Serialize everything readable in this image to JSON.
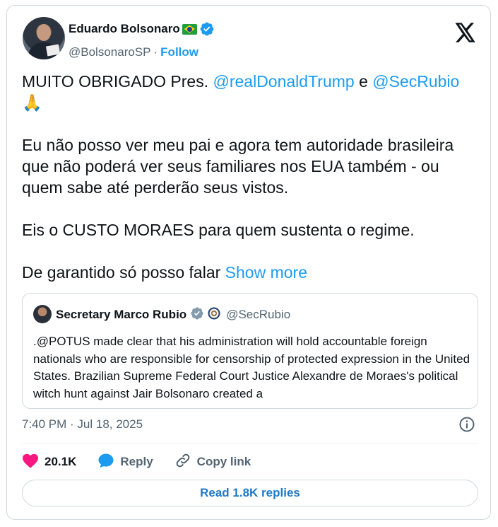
{
  "author": {
    "name": "Eduardo Bolsonaro",
    "handle": "@BolsonaroSP",
    "separator": "·",
    "follow_label": "Follow"
  },
  "tweet": {
    "line1_prefix": "MUITO OBRIGADO Pres. ",
    "mention1": "@realDonaldTrump",
    "line1_mid": " e ",
    "mention2": "@SecRubio",
    "emoji": "🙏",
    "para2": "Eu não posso ver meu pai e agora tem autoridade brasileira que não poderá ver seus familiares nos EUA também - ou quem sabe até perderão seus vistos.",
    "para3": "Eis o CUSTO MORAES para quem sustenta o regime.",
    "para4": "De garantido só posso falar ",
    "show_more": "Show more"
  },
  "quote": {
    "name": "Secretary Marco Rubio",
    "handle": "@SecRubio",
    "text": ".@POTUS made clear that his administration will hold accountable foreign nationals who are responsible for censorship of protected expression in the United States. Brazilian Supreme Federal Court Justice Alexandre de Moraes's political witch hunt against Jair Bolsonaro created a"
  },
  "meta": {
    "timestamp": "7:40 PM · Jul 18, 2025"
  },
  "actions": {
    "like_count": "20.1K",
    "reply_label": "Reply",
    "copy_label": "Copy link",
    "read_replies": "Read 1.8K replies"
  },
  "colors": {
    "accent": "#1d9bf0",
    "like": "#f91880",
    "muted": "#536471"
  },
  "icons": [
    "verified-icon",
    "flag-brazil-icon",
    "x-logo-icon",
    "government-seal-icon",
    "info-icon",
    "heart-icon",
    "reply-icon",
    "link-icon"
  ]
}
